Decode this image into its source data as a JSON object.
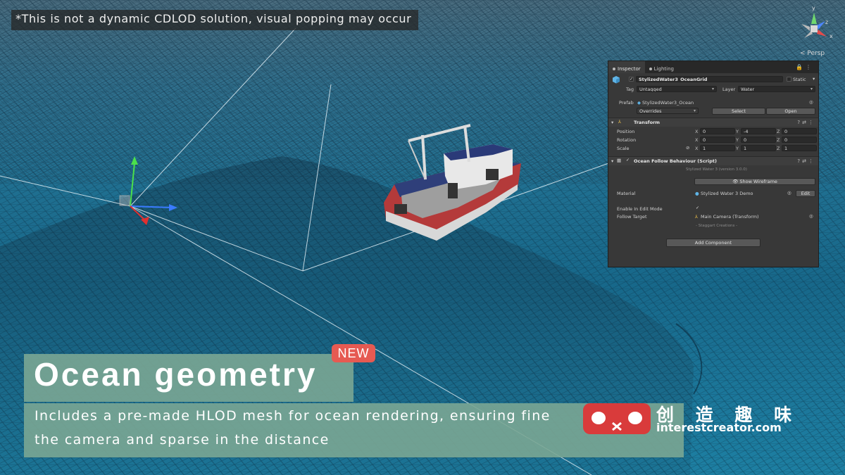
{
  "viewport": {
    "notice": "*This is not a dynamic CDLOD solution, visual popping may occur",
    "view_mode": "< Persp",
    "gizmo_axes": {
      "y": "y",
      "z": "z",
      "x": "x"
    }
  },
  "inspector": {
    "tabs": [
      {
        "label": "Inspector",
        "icon": "info-icon",
        "active": true
      },
      {
        "label": "Lighting",
        "icon": "light-icon",
        "active": false
      }
    ],
    "object": {
      "name": "StylizedWater3_OceanGrid",
      "static_label": "Static",
      "tag_label": "Tag",
      "tag_value": "Untagged",
      "layer_label": "Layer",
      "layer_value": "Water"
    },
    "prefab": {
      "label": "Prefab",
      "value": "StylizedWater3_Ocean",
      "overrides_label": "Overrides",
      "select_label": "Select",
      "open_label": "Open"
    },
    "transform": {
      "title": "Transform",
      "rows": [
        {
          "label": "Position",
          "x": "0",
          "y": "-4",
          "z": "0"
        },
        {
          "label": "Rotation",
          "x": "0",
          "y": "0",
          "z": "0"
        },
        {
          "label": "Scale",
          "x": "1",
          "y": "1",
          "z": "1"
        }
      ]
    },
    "component": {
      "title": "Ocean Follow Behaviour (Script)",
      "version_text": "Stylized Water 3 (version 3.0.0)",
      "wireframe_button": "Show Wireframe",
      "material_label": "Material",
      "material_value": "Stylized Water 3 Demo",
      "edit_label": "Edit",
      "edit_mode_label": "Enable In Edit Mode",
      "follow_target_label": "Follow Target",
      "follow_target_value": "Main Camera (Transform)",
      "stagger_text": "- Staggart Creations -"
    },
    "add_component_label": "Add Component"
  },
  "caption": {
    "badge": "NEW",
    "title": "Ocean geometry",
    "line1": "Includes a pre-made HLOD mesh for ocean rendering, ensuring fine",
    "line2": "the camera and sparse in the distance"
  },
  "watermark": {
    "cn_text": "创 造 趣 味",
    "url": "interestcreator.com"
  },
  "colors": {
    "ocean": "#1b6f91",
    "caption_bg": "#7aa694",
    "badge": "#e65a52",
    "inspector_bg": "#383838",
    "watermark_logo": "#d93b3b"
  }
}
